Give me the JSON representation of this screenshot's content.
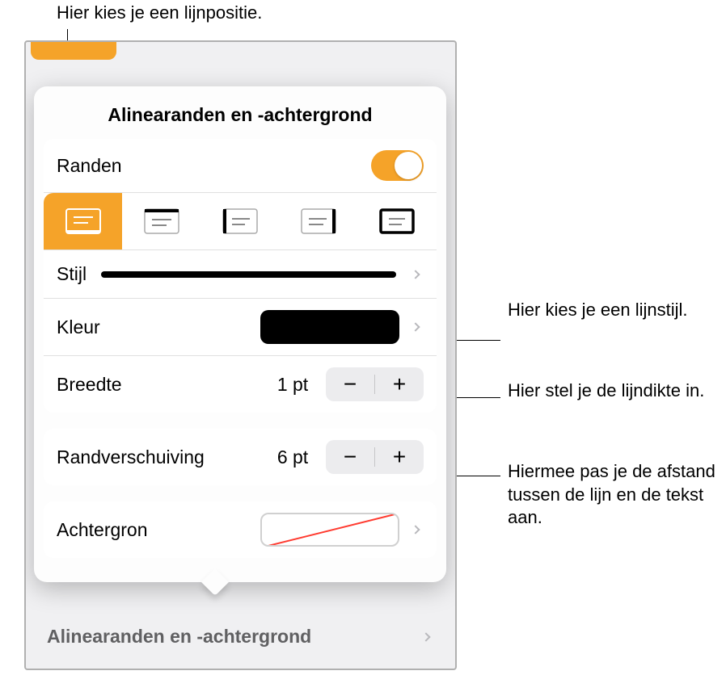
{
  "callouts": {
    "top": "Hier kies je een lijnpositie.",
    "style": "Hier kies je een lijnstijl.",
    "width": "Hier stel je de lijndikte in.",
    "offset": "Hiermee pas je de afstand tussen de lijn en de tekst aan."
  },
  "popover": {
    "title": "Alinearanden en -achtergrond",
    "borders_label": "Randen",
    "style_label": "Stijl",
    "color_label": "Kleur",
    "width_label": "Breedte",
    "width_value": "1 pt",
    "offset_label": "Randverschuiving",
    "offset_value": "6 pt",
    "background_label": "Achtergron",
    "bottom_label": "Alinearanden en -achtergrond"
  },
  "stepper": {
    "minus": "−",
    "plus": "+"
  }
}
